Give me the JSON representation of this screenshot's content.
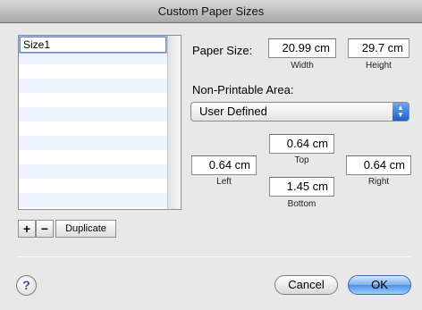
{
  "window": {
    "title": "Custom Paper Sizes"
  },
  "list": {
    "items": [
      "Size1"
    ]
  },
  "list_buttons": {
    "add": "+",
    "remove": "−",
    "duplicate": "Duplicate"
  },
  "paper_size": {
    "label": "Paper Size:",
    "width_value": "20.99 cm",
    "width_label": "Width",
    "height_value": "29.7 cm",
    "height_label": "Height"
  },
  "non_printable": {
    "label": "Non-Printable Area:",
    "selected": "User Defined",
    "top_value": "0.64 cm",
    "top_label": "Top",
    "left_value": "0.64 cm",
    "left_label": "Left",
    "right_value": "0.64 cm",
    "right_label": "Right",
    "bottom_value": "1.45 cm",
    "bottom_label": "Bottom"
  },
  "footer": {
    "help": "?",
    "cancel": "Cancel",
    "ok": "OK"
  }
}
